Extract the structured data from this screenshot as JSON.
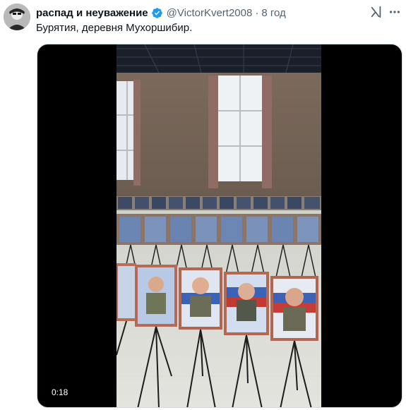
{
  "post": {
    "display_name": "распад и неуважение",
    "handle": "@VictorKvert2008",
    "separator": "·",
    "time": "8 год",
    "text": "Бурятия, деревня Мухоршибир."
  },
  "icons": {
    "avatar": "avatar-image",
    "verified": "verified-badge-icon",
    "grok": "grok-icon",
    "more": "more-options-icon"
  },
  "video": {
    "timestamp": "0:18"
  },
  "colors": {
    "verified_blue": "#1d9bf0",
    "secondary_text": "#536471",
    "primary_text": "#0f1419"
  }
}
